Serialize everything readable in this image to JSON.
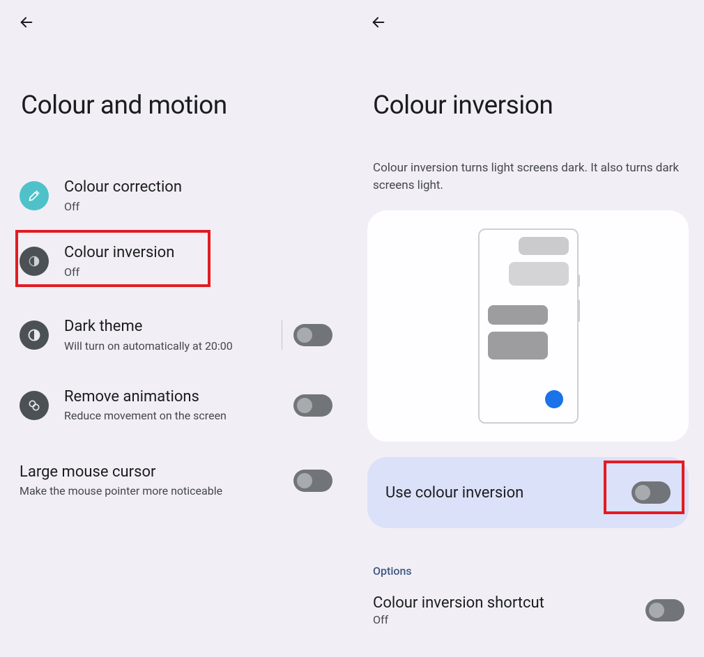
{
  "left": {
    "title": "Colour and motion",
    "items": [
      {
        "title": "Colour correction",
        "sub": "Off"
      },
      {
        "title": "Colour inversion",
        "sub": "Off"
      },
      {
        "title": "Dark theme",
        "sub": "Will turn on automatically at 20:00"
      },
      {
        "title": "Remove animations",
        "sub": "Reduce movement on the screen"
      },
      {
        "title": "Large mouse cursor",
        "sub": "Make the mouse pointer more noticeable"
      }
    ]
  },
  "right": {
    "title": "Colour inversion",
    "description": "Colour inversion turns light screens dark. It also turns dark screens light.",
    "use_label": "Use colour inversion",
    "options_label": "Options",
    "shortcut": {
      "title": "Colour inversion shortcut",
      "sub": "Off"
    }
  }
}
